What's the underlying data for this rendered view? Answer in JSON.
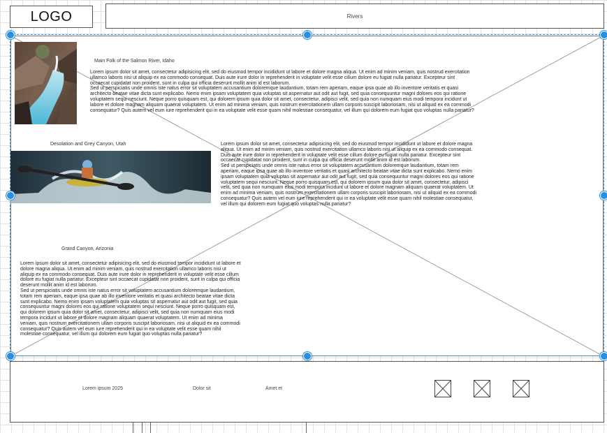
{
  "header": {
    "logo_text": "LOGO",
    "nav_text": "Rivers"
  },
  "sections": [
    {
      "caption": "Main Folk of the Salmon River, Idaho",
      "image_icon": "river-gorge-photo",
      "paragraphs": [
        "Lorem ipsum dolor sit amet, consectetur adipisicing elit, sed do eiusmod tempor incididunt ut labore et dolore magna aliqua. Ut enim ad minim veniam, quis nostrud exercitation ullamco laboris nisi ut aliquip ex ea commodo consequat. Duis aute irure dolor in reprehenderit in voluptate velit esse cillum dolore eu fugiat nulla pariatur. Excepteur sint occaecat cupidatat non proident, sunt in culpa qui officia deserunt mollit anim id est laborum.",
        "Sed ut perspiciatis unde omnis iste natus error sit voluptatem accusantium doloremque laudantium, totam rem aperiam, eaque ipsa quae ab illo inventore veritatis et quasi architecto beatae vitae dicta sunt explicabo. Nemo enim ipsam voluptatem quia voluptas sit aspernatur aut odit aut fugit, sed quia consequuntur magni dolores eos qui ratione voluptatem sequi nesciunt. Neque porro quisquam est, qui dolorem ipsum quia dolor sit amet, consectetur, adipisci velit, sed quia non numquam eius modi tempora incidunt ut labore et dolore magnam aliquam quaerat voluptatem. Ut enim ad minima veniam, quis nostrum exercitationem ullam corporis suscipit laboriosam, nisi ut aliquid ex ea commodi consequatur? Quis autem vel eum iure reprehenderit qui in ea voluptate velit esse quam nihil molestiae consequatur, vel illum qui dolorem eum fugiat quo voluptas nulla pariatur?"
      ]
    },
    {
      "caption": "Desolation and Grey Canyon, Utah",
      "image_icon": "kayaker-photo",
      "paragraphs": [
        "Lorem ipsum dolor sit amet, consectetur adipisicing elit, sed do eiusmod tempor incididunt ut labore et dolore magna aliqua. Ut enim ad minim veniam, quis nostrud exercitation ullamco laboris nisi ut aliquip ex ea commodo consequat. Duis aute irure dolor in reprehenderit in voluptate velit esse cillum dolore eu fugiat nulla pariatur. Excepteur sint occaecat cupidatat non proident, sunt in culpa qui officia deserunt mollit anim id est laborum.",
        "Sed ut perspiciatis unde omnis iste natus error sit voluptatem accusantium doloremque laudantium, totam rem aperiam, eaque ipsa quae ab illo inventore veritatis et quasi architecto beatae vitae dicta sunt explicabo. Nemo enim ipsam voluptatem quia voluptas sit aspernatur aut odit aut fugit, sed quia consequuntur magni dolores eos qui ratione voluptatem sequi nesciunt. Neque porro quisquam est, qui dolorem ipsum quia dolor sit amet, consectetur, adipisci velit, sed quia non numquam eius modi tempora incidunt ut labore et dolore magnam aliquam quaerat voluptatem. Ut enim ad minima veniam, quis nostrum exercitationem ullam corporis suscipit laboriosam, nisi ut aliquid ex ea commodi consequatur? Quis autem vel eum iure reprehenderit qui in ea voluptate velit esse quam nihil molestiae consequatur, vel illum qui dolorem eum fugiat quo voluptas nulla pariatur?"
      ]
    },
    {
      "caption": "Grand Canyon, Arizonia",
      "paragraphs": [
        "Lorem ipsum dolor sit amet, consectetur adipisicing elit, sed do eiusmod tempor incididunt ut labore et dolore magna aliqua. Ut enim ad minim veniam, quis nostrud exercitation ullamco laboris nisi ut aliquip ex ea commodo consequat. Duis aute irure dolor in reprehenderit in voluptate velit esse cillum dolore eu fugiat nulla pariatur. Excepteur sint occaecat cupidatat non proident, sunt in culpa qui officia deserunt mollit anim id est laborum.",
        "Sed ut perspiciatis unde omnis iste natus error sit voluptatem accusantium doloremque laudantium, totam rem aperiam, eaque ipsa quae ab illo inventore veritatis et quasi architecto beatae vitae dicta sunt explicabo. Nemo enim ipsam voluptatem quia voluptas sit aspernatur aut odit aut fugit, sed quia consequuntur magni dolores eos qui ratione voluptatem sequi nesciunt. Neque porro quisquam est, qui dolorem ipsum quia dolor sit amet, consectetur, adipisci velit, sed quia non numquam eius modi tempora incidunt ut labore et dolore magnam aliquam quaerat voluptatem. Ut enim ad minima veniam, quis nostrum exercitationem ullam corporis suscipit laboriosam, nisi ut aliquid ex ea commodi consequatur? Quis autem vel eum iure reprehenderit qui in ea voluptate velit esse quam nihil molestiae consequatur, vel illum qui dolorem eum fugiat quo voluptas nulla pariatur?"
      ]
    }
  ],
  "footer": {
    "links": [
      "Lorem ipsum 2025",
      "Dolor sit",
      "Amet et"
    ],
    "placeholder_icons": [
      "image-placeholder-icon",
      "image-placeholder-icon",
      "image-placeholder-icon"
    ]
  },
  "colors": {
    "selection": "#2b8fe0",
    "border": "#555555",
    "grid": "#e2e2e2"
  }
}
